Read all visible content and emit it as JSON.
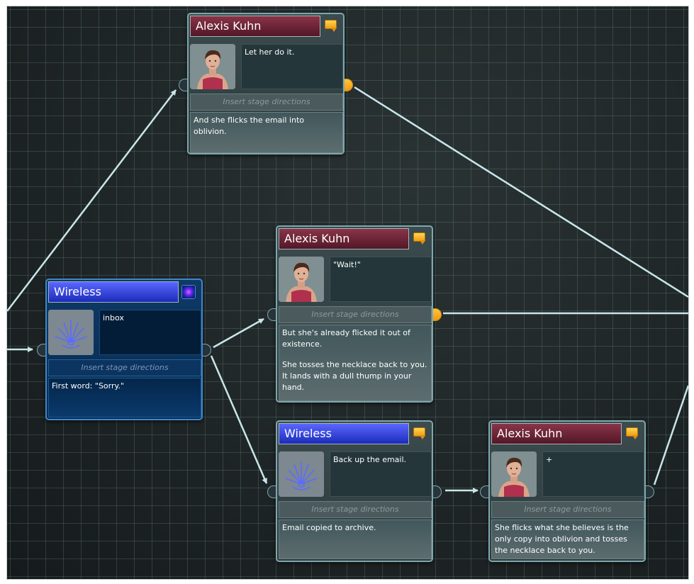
{
  "nodes": [
    {
      "id": "n1",
      "speaker": "Alexis Kuhn",
      "speaker_color": "#8a3448",
      "badge_icon": "comment-bubble-icon",
      "portrait": "alexis-portrait",
      "line": "Let her do it.",
      "stage_placeholder": "Insert stage directions",
      "body": [
        "And she flicks the email into oblivion."
      ]
    },
    {
      "id": "n2",
      "speaker": "Alexis Kuhn",
      "speaker_color": "#8a3448",
      "badge_icon": "comment-bubble-icon",
      "portrait": "alexis-portrait",
      "line": "\"Wait!\"",
      "stage_placeholder": "Insert stage directions",
      "body": [
        "But she's already flicked it out of existence.",
        "She tosses the necklace back to you. It lands with a dull thump in your hand."
      ]
    },
    {
      "id": "n3",
      "speaker": "Wireless",
      "speaker_color": "#3a48e0",
      "badge_icon": "galaxy-icon",
      "portrait": "wireless-portrait",
      "line": "inbox",
      "stage_placeholder": "Insert stage directions",
      "body": [
        "First word: \"Sorry.\""
      ],
      "selected": true
    },
    {
      "id": "n4",
      "speaker": "Wireless",
      "speaker_color": "#3a48e0",
      "badge_icon": "comment-bubble-icon",
      "portrait": "wireless-portrait",
      "line": "Back up the email.",
      "stage_placeholder": "Insert stage directions",
      "body": [
        "Email copied to archive."
      ]
    },
    {
      "id": "n5",
      "speaker": "Alexis Kuhn",
      "speaker_color": "#8a3448",
      "badge_icon": "comment-bubble-icon",
      "portrait": "alexis-portrait",
      "line": "+",
      "stage_placeholder": "Insert stage directions",
      "body": [
        "She flicks what she believes is the only copy into oblivion and tosses the necklace back to you."
      ]
    }
  ],
  "colors": {
    "canvas_bg": "#1e2526",
    "wire": "#c8e6ea",
    "port_active": "#f5a623",
    "selected_border": "#3f86c9"
  }
}
